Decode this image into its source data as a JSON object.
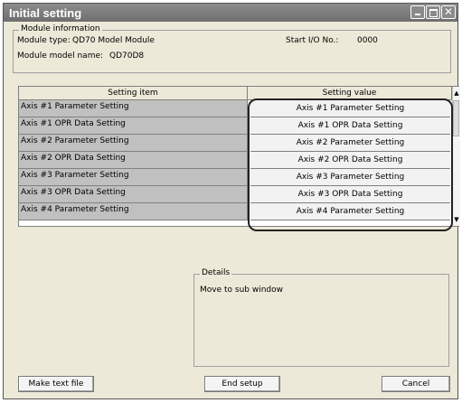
{
  "window": {
    "title": "Initial setting",
    "close_glyph": "✕"
  },
  "module_info": {
    "legend": "Module information",
    "type_label": "Module type:",
    "type_value": "QD70 Model Module",
    "start_io_label": "Start I/O No.:",
    "start_io_value": "0000",
    "model_label": "Module model name:",
    "model_value": "QD70D8"
  },
  "table": {
    "headers": [
      "Setting item",
      "Setting value"
    ],
    "rows": [
      {
        "item": "Axis #1 Parameter Setting",
        "value": "Axis #1 Parameter Setting"
      },
      {
        "item": "Axis #1 OPR Data Setting",
        "value": "Axis #1 OPR Data Setting"
      },
      {
        "item": "Axis #2 Parameter Setting",
        "value": "Axis #2 Parameter Setting"
      },
      {
        "item": "Axis #2 OPR Data Setting",
        "value": "Axis #2 OPR Data Setting"
      },
      {
        "item": "Axis #3 Parameter Setting",
        "value": "Axis #3 Parameter Setting"
      },
      {
        "item": "Axis #3 OPR Data Setting",
        "value": "Axis #3 OPR Data Setting"
      },
      {
        "item": "Axis #4 Parameter Setting",
        "value": "Axis #4 Parameter Setting"
      }
    ]
  },
  "details": {
    "legend": "Details",
    "text": "Move to sub window"
  },
  "buttons": {
    "make_text_file": "Make text file",
    "end_setup": "End setup",
    "cancel": "Cancel"
  },
  "scroll": {
    "up": "▲",
    "down": "▼"
  }
}
